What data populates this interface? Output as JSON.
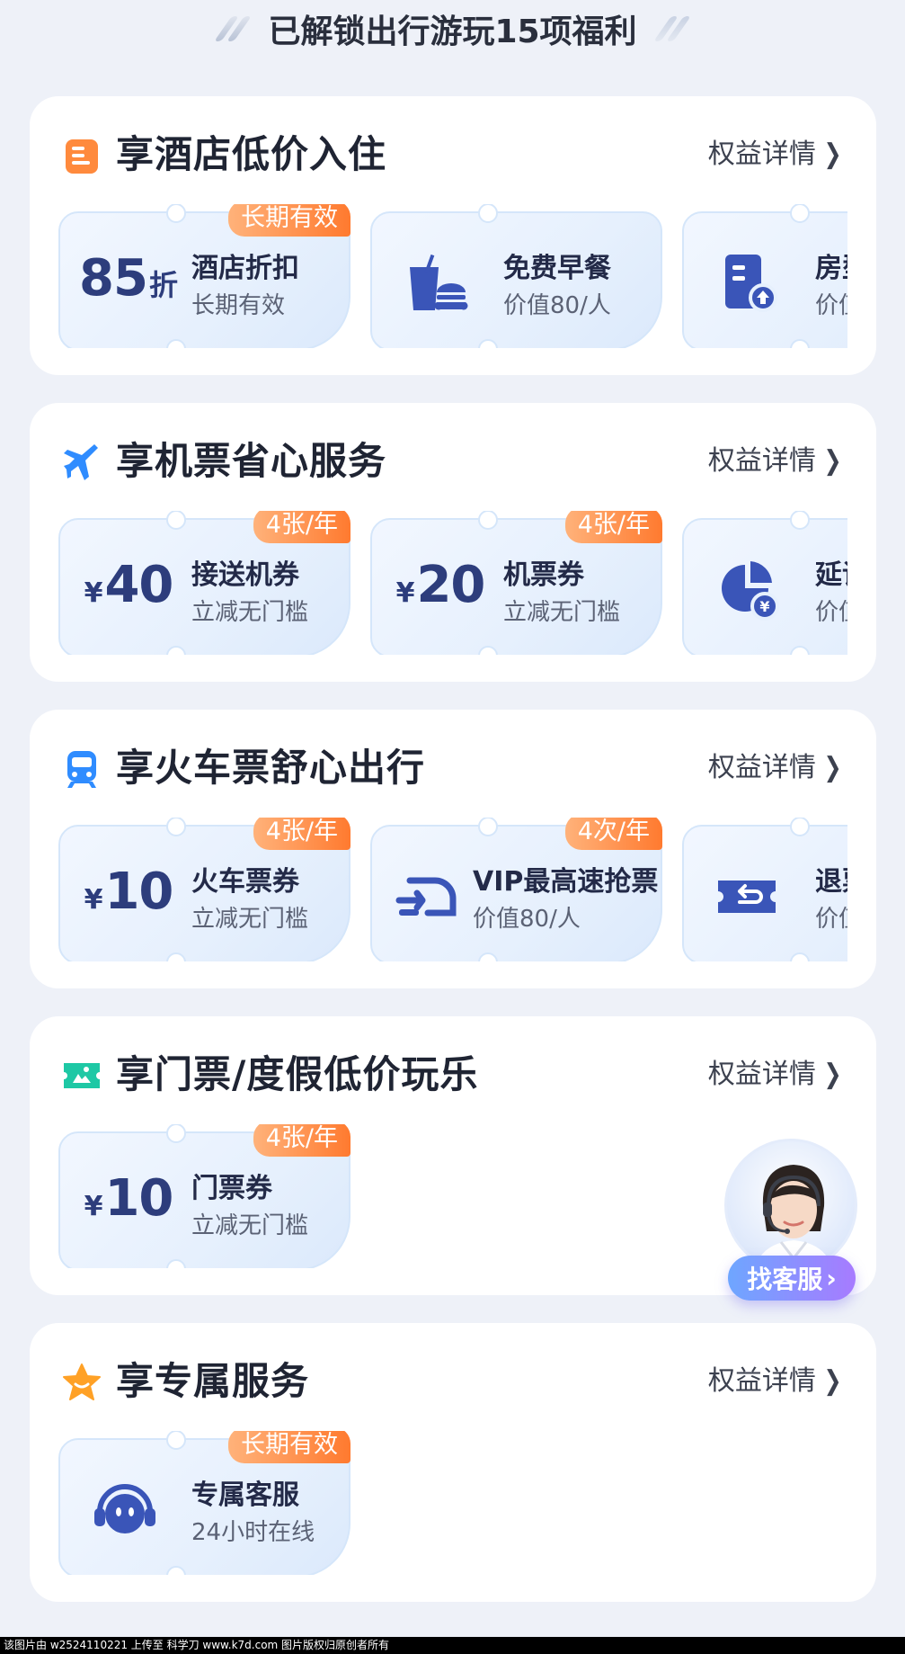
{
  "header": {
    "title": "已解锁出行游玩15项福利"
  },
  "colors": {
    "accent_blue": "#2d3d7c",
    "badge_orange": "#ff7a2f",
    "card_bg": "#e6f0fd",
    "page_bg": "#eef1f8"
  },
  "sections": [
    {
      "title": "享酒店低价入住",
      "icon": "hotel-icon",
      "link": "权益详情",
      "cards": [
        {
          "badge": "长期有效",
          "num": "85",
          "unit": "折",
          "name": "酒店折扣",
          "sub": "长期有效"
        },
        {
          "icon": "breakfast-icon",
          "name": "免费早餐",
          "sub": "价值80/人"
        },
        {
          "icon": "room-upgrade-icon",
          "name": "房型",
          "sub": "价值"
        }
      ]
    },
    {
      "title": "享机票省心服务",
      "icon": "airplane-icon",
      "link": "权益详情",
      "cards": [
        {
          "badge": "4张/年",
          "cur": "¥",
          "num": "40",
          "name": "接送机券",
          "sub": "立减无门槛"
        },
        {
          "badge": "4张/年",
          "cur": "¥",
          "num": "20",
          "name": "机票券",
          "sub": "立减无门槛"
        },
        {
          "icon": "delay-insurance-icon",
          "name": "延误",
          "sub": "价值"
        }
      ]
    },
    {
      "title": "享火车票舒心出行",
      "icon": "train-icon",
      "link": "权益详情",
      "cards": [
        {
          "badge": "4张/年",
          "cur": "¥",
          "num": "10",
          "name": "火车票券",
          "sub": "立减无门槛"
        },
        {
          "badge": "4次/年",
          "icon": "fast-grab-icon",
          "name": "VIP最高速抢票",
          "sub": "价值80/人"
        },
        {
          "icon": "refund-ticket-icon",
          "name": "退票",
          "sub": "价值"
        }
      ]
    },
    {
      "title": "享门票/度假低价玩乐",
      "icon": "scenic-ticket-icon",
      "link": "权益详情",
      "cards": [
        {
          "badge": "4张/年",
          "cur": "¥",
          "num": "10",
          "name": "门票券",
          "sub": "立减无门槛"
        }
      ]
    },
    {
      "title": "享专属服务",
      "icon": "star-icon",
      "link": "权益详情",
      "cards": [
        {
          "badge": "长期有效",
          "icon": "robot-service-icon",
          "name": "专属客服",
          "sub": "24小时在线"
        }
      ]
    }
  ],
  "customer_service": {
    "label": "找客服",
    "arrow": "›"
  },
  "footer": {
    "text": "该图片由 w2524110221 上传至 科学刀 www.k7d.com 图片版权归原创者所有"
  }
}
